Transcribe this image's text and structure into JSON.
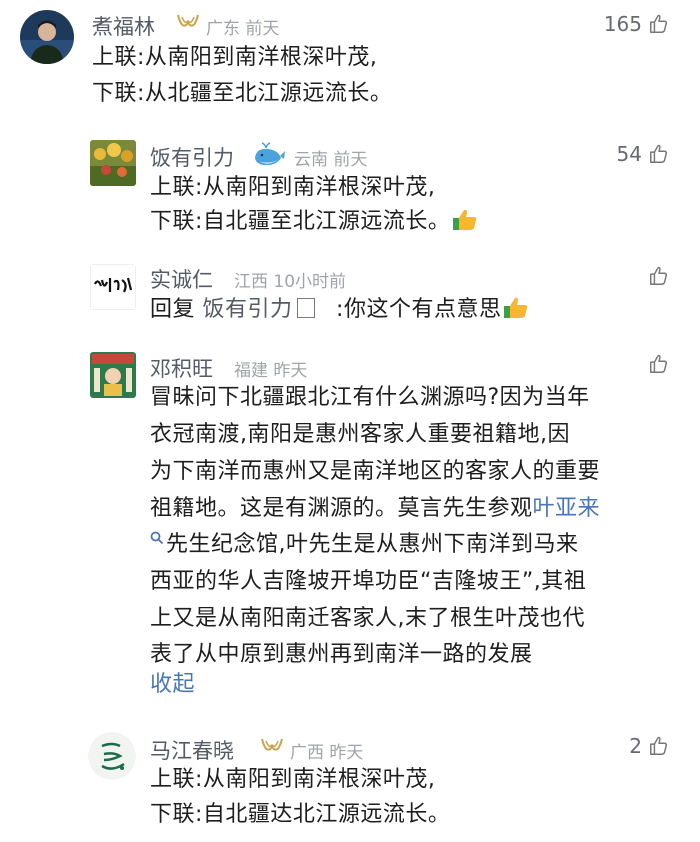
{
  "comments": [
    {
      "name": "煮福林",
      "location": "广东",
      "time": "前天",
      "likes": "165",
      "lines": [
        "上联:从南阳到南洋根深叶茂,",
        "下联:从北疆至北江源远流长。"
      ]
    },
    {
      "name": "饭有引力",
      "location": "云南",
      "time": "前天",
      "likes": "54",
      "lines": [
        "上联:从南阳到南洋根深叶茂,",
        "下联:自北疆至北江源远流长。"
      ]
    },
    {
      "name": "实诚仁",
      "location": "江西",
      "time": "10小时前",
      "likes": "",
      "reply_prefix": "回复",
      "reply_to": "饭有引力",
      "reply_text": ":你这个有点意思"
    },
    {
      "name": "邓积旺",
      "location": "福建",
      "time": "昨天",
      "likes": "",
      "lines": [
        "冒昧问下北疆跟北江有什么渊源吗?因为当年",
        "衣冠南渡,南阳是惠州客家人重要祖籍地,因",
        "为下南洋而惠州又是南洋地区的客家人的重要",
        "祖籍地。这是有渊源的。莫言先生参观"
      ],
      "link_text": "叶亚来",
      "line5": "先生纪念馆,叶先生是从惠州下南洋到马来",
      "more_lines": [
        "西亚的华人吉隆坡开埠功臣“吉隆坡王”,其祖",
        "上又是从南阳南迁客家人,末了根生叶茂也代",
        "表了从中原到惠州再到南洋一路的发展"
      ],
      "collapse": "收起"
    },
    {
      "name": "马江春晓",
      "location": "广西",
      "time": "昨天",
      "likes": "2",
      "lines": [
        "上联:从南阳到南洋根深叶茂,",
        "下联:自北疆达北江源远流长。"
      ]
    }
  ],
  "avatar_texts": {
    "shicheng": "勤则道天"
  }
}
